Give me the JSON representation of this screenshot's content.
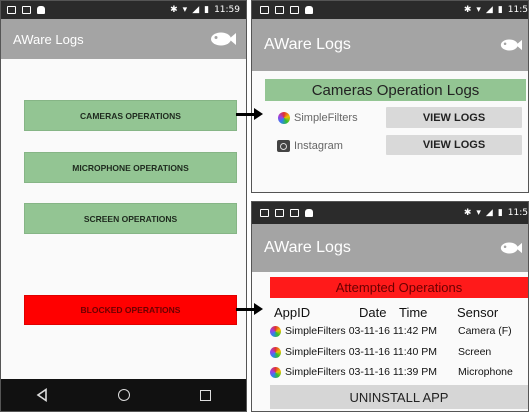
{
  "status_bar": {
    "time": "11:59",
    "time_cropped": "11:5"
  },
  "app": {
    "title": "AWare Logs",
    "logo_icon": "fish-icon"
  },
  "main_screen": {
    "buttons": [
      {
        "label": "CAMERAS OPERATIONS"
      },
      {
        "label": "MICROPHONE OPERATIONS"
      },
      {
        "label": "SCREEN OPERATIONS"
      },
      {
        "label": "BLOCKED OPERATIONS"
      }
    ],
    "nav": {
      "back_icon": "back-icon",
      "home_icon": "home-icon",
      "recents_icon": "recents-icon"
    }
  },
  "cameras_screen": {
    "header": "Cameras Operation Logs",
    "apps": [
      {
        "name": "SimpleFilters",
        "action": "VIEW LOGS"
      },
      {
        "name": "Instagram",
        "action": "VIEW LOGS"
      }
    ]
  },
  "blocked_screen": {
    "header": "Attempted Operations",
    "columns": {
      "app": "AppID",
      "date": "Date",
      "time": "Time",
      "sensor": "Sensor"
    },
    "rows": [
      {
        "app": "SimpleFilters",
        "datetime": "03-11-16 11:42 PM",
        "sensor": "Camera (F)"
      },
      {
        "app": "SimpleFilters",
        "datetime": "03-11-16 11:40 PM",
        "sensor": "Screen"
      },
      {
        "app": "SimpleFilters",
        "datetime": "03-11-16 11:39 PM",
        "sensor": "Microphone"
      }
    ],
    "action": "UNINSTALL APP"
  },
  "colors": {
    "appbar": "#a4a4a4",
    "green_button": "#93c593",
    "red_button": "#ff0000",
    "status_bar": "#2b2b2b"
  }
}
